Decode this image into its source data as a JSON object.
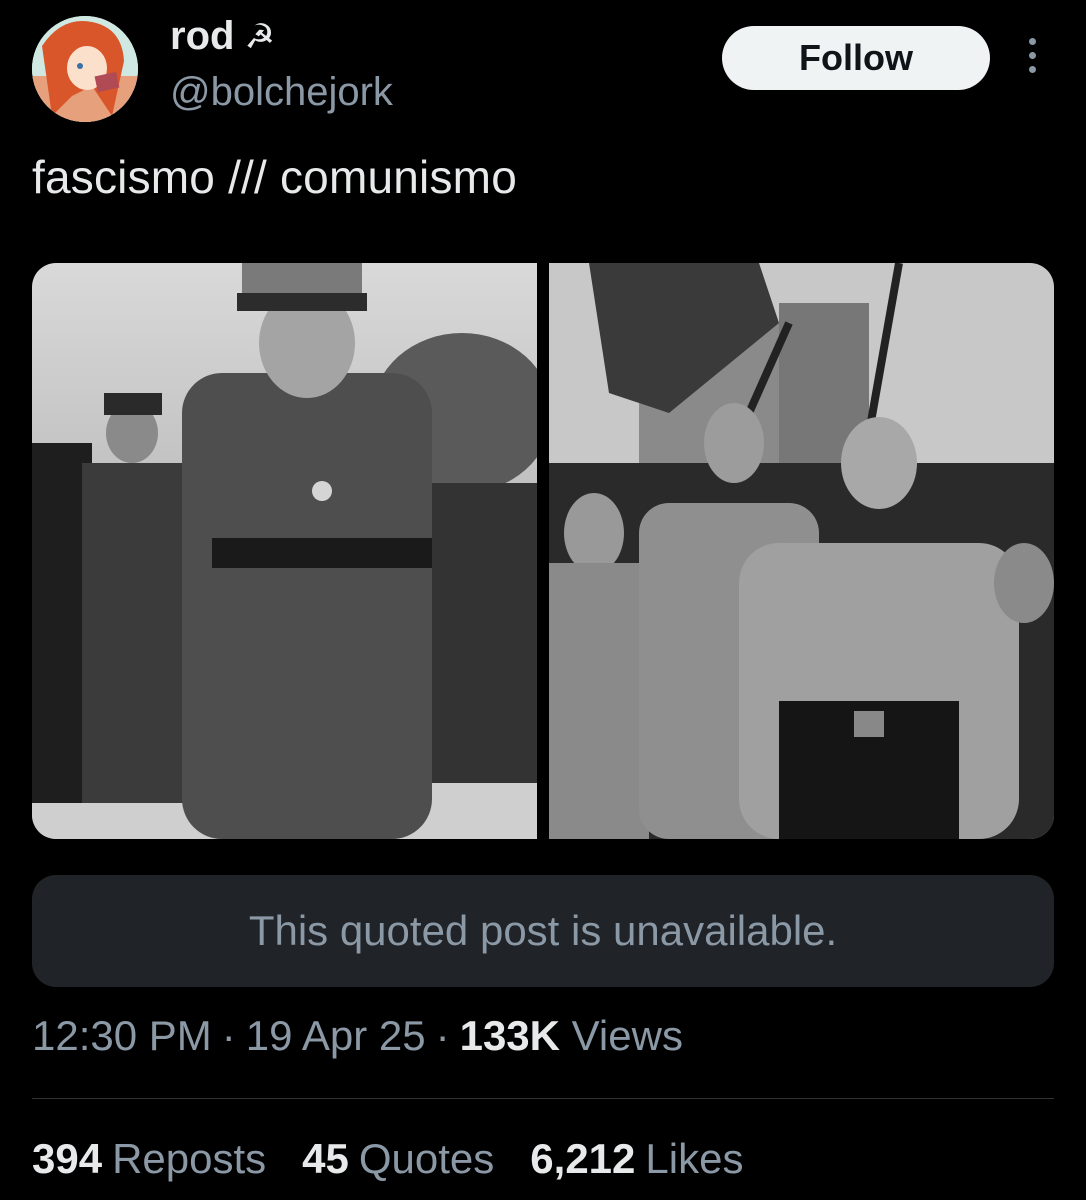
{
  "author": {
    "display_name": "rod",
    "name_emoji": "☭",
    "handle": "@bolchejork"
  },
  "actions": {
    "follow_label": "Follow"
  },
  "post": {
    "text": "fascismo /// comunismo"
  },
  "quote": {
    "unavailable_text": "This quoted post is unavailable."
  },
  "meta": {
    "time": "12:30 PM",
    "separator": "·",
    "date": "19 Apr 25",
    "views_count": "133K",
    "views_label": "Views"
  },
  "stats": {
    "reposts_count": "394",
    "reposts_label": "Reposts",
    "quotes_count": "45",
    "quotes_label": "Quotes",
    "likes_count": "6,212",
    "likes_label": "Likes"
  },
  "colors": {
    "background": "#000000",
    "text_primary": "#e7e9ea",
    "text_secondary": "#8b98a5",
    "quote_bg": "#202327",
    "follow_bg": "#eff3f4"
  }
}
